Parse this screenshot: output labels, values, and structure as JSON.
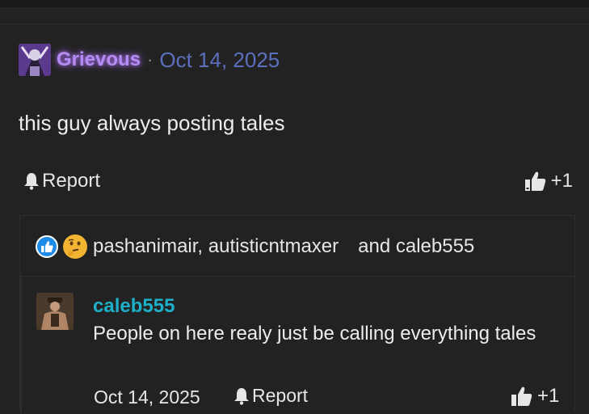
{
  "post": {
    "author": "Grievous",
    "separator": "·",
    "date": "Oct 14, 2025",
    "body": "this guy always posting tales",
    "report_label": "Report",
    "like_count": "+1"
  },
  "reactions": {
    "names": "pashanimair, autisticntmaxer",
    "and_text": "and caleb555",
    "icons": [
      "thumbs-up-reaction",
      "thinking-face-reaction"
    ]
  },
  "reply": {
    "author": "caleb555",
    "body": "People on here realy just be calling everything tales",
    "date": "Oct 14, 2025",
    "report_label": "Report",
    "like_count": "+1"
  },
  "colors": {
    "background": "#222222",
    "author_glow": "#b78cf2",
    "date_link": "#5b6fbf",
    "reply_author": "#1db0c8"
  }
}
